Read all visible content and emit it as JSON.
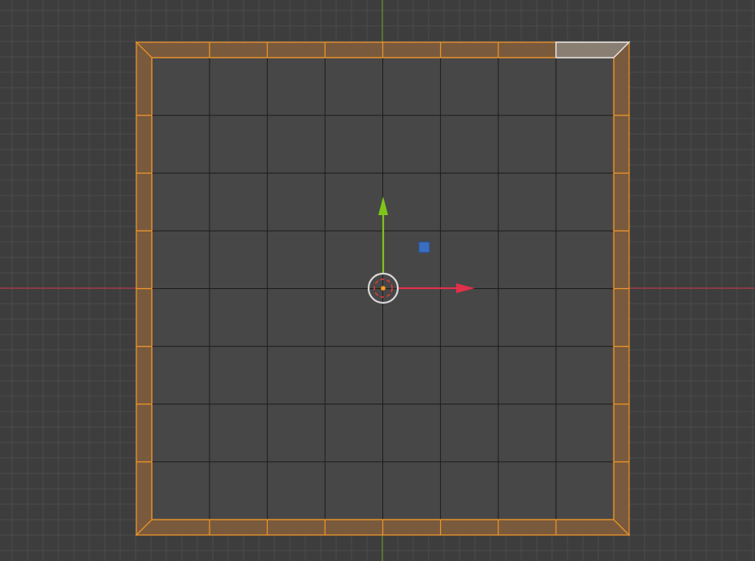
{
  "viewport": {
    "view": "top-orthographic",
    "mode": "edit-mode",
    "selection_mode": "face",
    "colors": {
      "background": "#3d3d3d",
      "grid_line": "#4b4b4b",
      "x_axis": "#b63b4b",
      "y_axis": "#6a9a2a",
      "mesh_face": "#474747",
      "mesh_wire": "#1c1c1c",
      "selected_face": "#7a5a3c",
      "selected_edge": "#f0962a",
      "active_face": "#8a7e72",
      "active_edge": "#e6e6e6"
    }
  },
  "gizmo": {
    "type": "move-gizmo",
    "x_handle_color": "#e0304a",
    "y_handle_color": "#7fc41a",
    "plane_handle_color": "#3a6ec0",
    "center_icon": "pivot-circle-icon"
  },
  "mesh": {
    "inner_divisions": 8,
    "frame_segments_per_side": 8,
    "active_face_position": "top-right-segment"
  }
}
